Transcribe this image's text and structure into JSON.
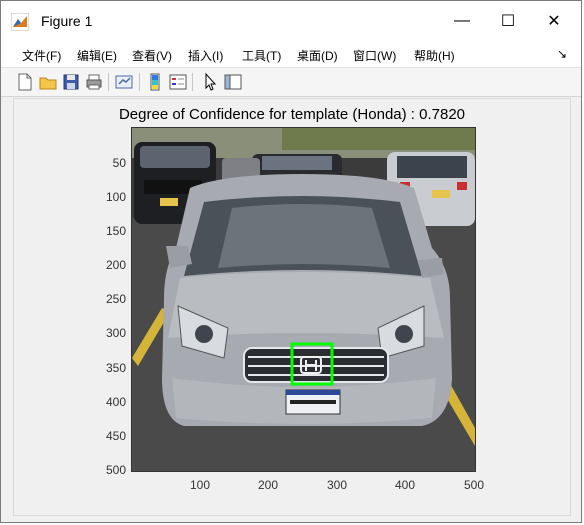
{
  "window": {
    "title": "Figure 1",
    "controls": {
      "minimize": "—",
      "maximize": "☐",
      "close": "✕"
    }
  },
  "menu": {
    "items": [
      "文件(F)",
      "编辑(E)",
      "查看(V)",
      "插入(I)",
      "工具(T)",
      "桌面(D)",
      "窗口(W)",
      "帮助(H)"
    ],
    "dock_arrow": "↘"
  },
  "toolbar": {
    "buttons": [
      "new-figure-icon",
      "open-file-icon",
      "save-icon",
      "print-icon",
      "link-plot-icon",
      "insert-colorbar-icon",
      "insert-legend-icon",
      "edit-plot-icon",
      "property-inspector-icon"
    ]
  },
  "plot": {
    "title": "Degree of Confidence for template (Honda) : 0.7820",
    "yticks": [
      "50",
      "100",
      "150",
      "200",
      "250",
      "300",
      "350",
      "400",
      "450",
      "500"
    ],
    "xticks": [
      "100",
      "200",
      "300",
      "400",
      "500"
    ],
    "image_alt": "photo of a silver car in a parking lot",
    "detection_box_color": "#00ff00"
  }
}
